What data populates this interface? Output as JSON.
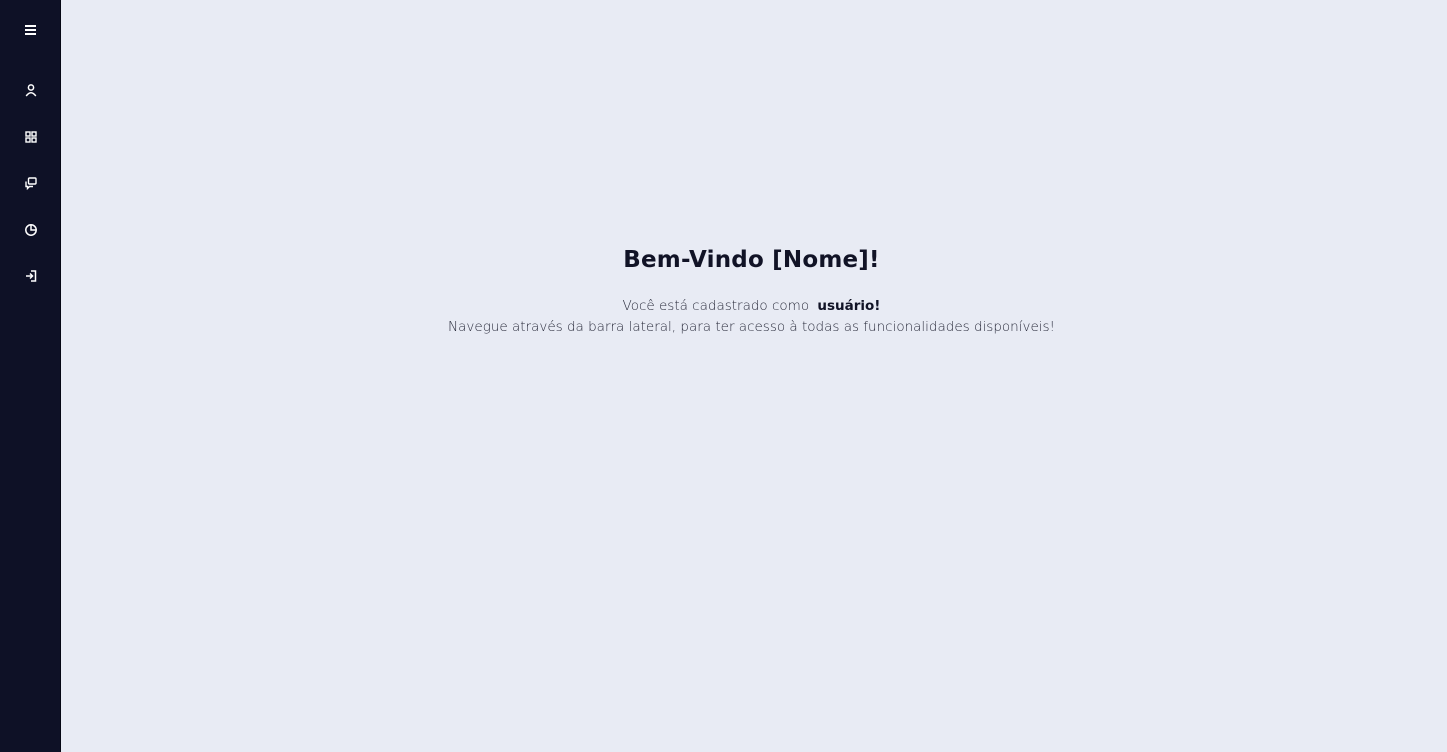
{
  "sidebar": {
    "items": [
      {
        "icon": "menu-icon"
      },
      {
        "icon": "user-icon"
      },
      {
        "icon": "grid-icon"
      },
      {
        "icon": "messages-icon"
      },
      {
        "icon": "chart-pie-icon"
      },
      {
        "icon": "logout-icon"
      }
    ],
    "background": "#0e1126",
    "icon_color": "#ffffff"
  },
  "main": {
    "background": "#e8ebf4",
    "title": "Bem-Vindo [Nome]!",
    "line1_prefix": "Você está cadastrado como",
    "line1_role": "usuário!",
    "line2": "Navegue através da barra lateral, para ter acesso à todas as funcionalidades disponíveis!"
  }
}
